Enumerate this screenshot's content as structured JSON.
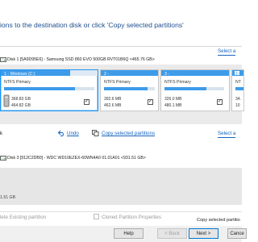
{
  "instruction": "ions to the destination disk or click 'Copy selected partitions'",
  "select_disk_link": "Select a",
  "select_disk_link_2": "Select a",
  "source_disk": {
    "label": "Disk 1 [5A9D95E6] - Samsung SSD 860 EVO 500GB RVT01B6Q  <465.76 GB>",
    "partitions": [
      {
        "name": "1 - Windows (C:)",
        "fs": "NTFS Primary",
        "used": "368.83 GB",
        "size": "464.82 GB",
        "fill": 0.79,
        "checked": true
      },
      {
        "name": "2 -",
        "fs": "NTFS Primary",
        "used": "392.6 MB",
        "size": "462.6 MB",
        "fill": 0.85,
        "checked": true
      },
      {
        "name": "3 -",
        "fs": "NTFS Primary",
        "used": "326.0 MB",
        "size": "480.1 MB",
        "fill": 0.68,
        "checked": true
      },
      {
        "name": "",
        "fs": "NT",
        "used": "34.",
        "size": "10",
        "fill": 0.4,
        "checked": false
      }
    ]
  },
  "toolbar": {
    "left_fragment": "k",
    "undo": "Undo",
    "copy_selected": "Copy selected partitions"
  },
  "dest_disk": {
    "label": "Disk 3 [912C2DB0] - WDC WD10EZEX-60WN4A0 01.01A01  <931.51 GB>",
    "size_fragment": "1.51 GB"
  },
  "options": {
    "delete_existing": "lete Existing partition",
    "cloned_props": "Cloned Partition Properties"
  },
  "status": "Copy selected partitio",
  "buttons": {
    "help": "Help",
    "back": "< Back",
    "next": "Next >",
    "cancel": "Cance"
  },
  "colors": {
    "accent": "#2196f3",
    "link": "#1565c0",
    "instruction": "#1e4f8e"
  }
}
